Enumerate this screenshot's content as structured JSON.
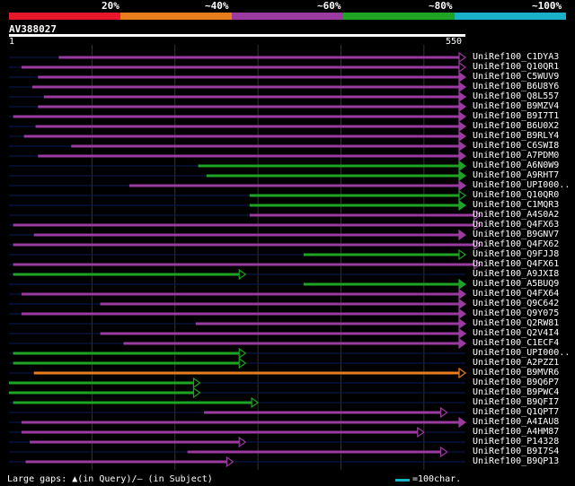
{
  "legend": {
    "labels": [
      "20%",
      "~40%",
      "~60%",
      "~80%",
      "~100%"
    ],
    "colors": [
      "#e8172a",
      "#e87d1e",
      "#9b3aa0",
      "#1fa324",
      "#19b1c6"
    ]
  },
  "query": {
    "id": "AV388027",
    "start_label": "1",
    "end_label": "550",
    "length": 550
  },
  "hits": [
    {
      "name": "UniRef100_C1DYA3",
      "start": 60,
      "end": 550,
      "color": "purple",
      "arrow": true
    },
    {
      "name": "UniRef100_Q10QR1",
      "start": 15,
      "end": 550,
      "color": "purple",
      "arrow": true
    },
    {
      "name": "UniRef100_C5WUV9",
      "start": 35,
      "end": 550,
      "color": "purple",
      "arrow": false
    },
    {
      "name": "UniRef100_B6U8Y6",
      "start": 28,
      "end": 550,
      "color": "purple",
      "arrow": false
    },
    {
      "name": "UniRef100_Q8L557",
      "start": 42,
      "end": 550,
      "color": "purple",
      "arrow": false
    },
    {
      "name": "UniRef100_B9MZV4",
      "start": 35,
      "end": 550,
      "color": "purple",
      "arrow": false
    },
    {
      "name": "UniRef100_B9I7T1",
      "start": 5,
      "end": 550,
      "color": "purple",
      "arrow": false
    },
    {
      "name": "UniRef100_B6U0X2",
      "start": 32,
      "end": 550,
      "color": "purple",
      "arrow": false
    },
    {
      "name": "UniRef100_B9RLY4",
      "start": 18,
      "end": 550,
      "color": "purple",
      "arrow": false
    },
    {
      "name": "UniRef100_C6SWI8",
      "start": 75,
      "end": 550,
      "color": "purple",
      "arrow": false
    },
    {
      "name": "UniRef100_A7PDM0",
      "start": 35,
      "end": 550,
      "color": "purple",
      "arrow": false
    },
    {
      "name": "UniRef100_A6N0W9",
      "start": 228,
      "end": 550,
      "color": "green",
      "arrow": false
    },
    {
      "name": "UniRef100_A9RHT7",
      "start": 238,
      "end": 550,
      "color": "green",
      "arrow": false
    },
    {
      "name": "UniRef100_UPI000..",
      "start": 145,
      "end": 550,
      "color": "purple",
      "arrow": false
    },
    {
      "name": "UniRef100_Q10QR0",
      "start": 290,
      "end": 550,
      "color": "green",
      "arrow": true
    },
    {
      "name": "UniRef100_C1MQR3",
      "start": 290,
      "end": 550,
      "color": "green",
      "arrow": false
    },
    {
      "name": "UniRef100_A4S0A2",
      "start": 290,
      "end": 568,
      "color": "purple",
      "arrow": true
    },
    {
      "name": "UniRef100_Q4FX63",
      "start": 5,
      "end": 568,
      "color": "purple",
      "arrow": true
    },
    {
      "name": "UniRef100_B9GNV7",
      "start": 30,
      "end": 550,
      "color": "purple",
      "arrow": false
    },
    {
      "name": "UniRef100_Q4FX62",
      "start": 5,
      "end": 568,
      "color": "purple",
      "arrow": true
    },
    {
      "name": "UniRef100_Q9FJJ8",
      "start": 355,
      "end": 550,
      "color": "green",
      "arrow": true
    },
    {
      "name": "UniRef100_Q4FX61",
      "start": 5,
      "end": 568,
      "color": "purple",
      "arrow": true
    },
    {
      "name": "UniRef100_A9JXI8",
      "start": 5,
      "end": 285,
      "color": "green",
      "arrow": true
    },
    {
      "name": "UniRef100_A5BUQ9",
      "start": 355,
      "end": 550,
      "color": "green",
      "arrow": false
    },
    {
      "name": "UniRef100_Q4FX64",
      "start": 15,
      "end": 550,
      "color": "purple",
      "arrow": false
    },
    {
      "name": "UniRef100_Q9C642",
      "start": 110,
      "end": 550,
      "color": "purple",
      "arrow": false
    },
    {
      "name": "UniRef100_Q9Y075",
      "start": 15,
      "end": 550,
      "color": "purple",
      "arrow": false
    },
    {
      "name": "UniRef100_Q2RW81",
      "start": 225,
      "end": 550,
      "color": "purple",
      "arrow": false
    },
    {
      "name": "UniRef100_Q2V4I4",
      "start": 110,
      "end": 550,
      "color": "purple",
      "arrow": false
    },
    {
      "name": "UniRef100_C1ECF4",
      "start": 138,
      "end": 550,
      "color": "purple",
      "arrow": false
    },
    {
      "name": "UniRef100_UPI000..",
      "start": 5,
      "end": 285,
      "color": "green",
      "arrow": true
    },
    {
      "name": "UniRef100_A2PZZ1",
      "start": 5,
      "end": 285,
      "color": "green",
      "arrow": true
    },
    {
      "name": "UniRef100_B9MVR6",
      "start": 30,
      "end": 550,
      "color": "orange",
      "arrow": true
    },
    {
      "name": "UniRef100_B9Q6P7",
      "start": 0,
      "end": 230,
      "color": "green",
      "arrow": true
    },
    {
      "name": "UniRef100_B9PWC4",
      "start": 0,
      "end": 230,
      "color": "green",
      "arrow": true
    },
    {
      "name": "UniRef100_B9QFI7",
      "start": 5,
      "end": 300,
      "color": "green",
      "arrow": true
    },
    {
      "name": "UniRef100_Q1QPT7",
      "start": 235,
      "end": 528,
      "color": "purple",
      "arrow": true
    },
    {
      "name": "UniRef100_A4IAU8",
      "start": 15,
      "end": 550,
      "color": "purple",
      "arrow": false
    },
    {
      "name": "UniRef100_A4HM87",
      "start": 15,
      "end": 500,
      "color": "purple",
      "arrow": true
    },
    {
      "name": "UniRef100_P14328",
      "start": 25,
      "end": 285,
      "color": "purple",
      "arrow": true
    },
    {
      "name": "UniRef100_B9I7S4",
      "start": 215,
      "end": 528,
      "color": "purple",
      "arrow": true
    },
    {
      "name": "UniRef100_B9QP13",
      "start": 20,
      "end": 270,
      "color": "purple",
      "arrow": true
    }
  ],
  "footer": {
    "large_gaps_label": "Large gaps: ▲(in Query)/– (in Subject)",
    "scale_label": "=100char."
  }
}
